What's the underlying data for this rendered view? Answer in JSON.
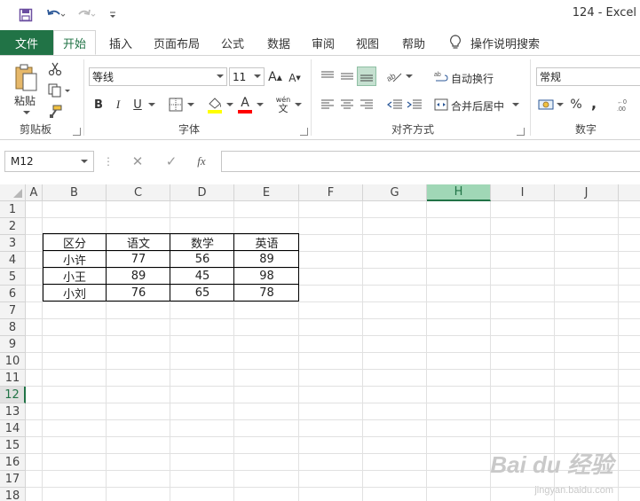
{
  "window": {
    "title": "124  -  Excel"
  },
  "tabs": [
    {
      "label": "文件"
    },
    {
      "label": "开始"
    },
    {
      "label": "插入"
    },
    {
      "label": "页面布局"
    },
    {
      "label": "公式"
    },
    {
      "label": "数据"
    },
    {
      "label": "审阅"
    },
    {
      "label": "视图"
    },
    {
      "label": "帮助"
    },
    {
      "label": "操作说明搜索"
    }
  ],
  "ribbon": {
    "clipboard": {
      "paste_label": "粘贴",
      "group_label": "剪贴板"
    },
    "font": {
      "name": "等线",
      "size": "11",
      "bold": "B",
      "italic": "I",
      "underline": "U",
      "grow": "A",
      "shrink": "A",
      "color_letter": "A",
      "phonetic": "wén",
      "phonetic_sub": "文",
      "group_label": "字体"
    },
    "alignment": {
      "wrap_label": "自动换行",
      "merge_label": "合并后居中",
      "group_label": "对齐方式"
    },
    "number": {
      "format": "常规",
      "percent": "%",
      "comma": ",",
      "group_label": "数字"
    }
  },
  "formula_bar": {
    "name_box": "M12",
    "fx": "fx",
    "cancel": "✕",
    "confirm": "✓",
    "value": ""
  },
  "sheet": {
    "columns": [
      "A",
      "B",
      "C",
      "D",
      "E",
      "F",
      "G",
      "H",
      "I",
      "J"
    ],
    "selected_column": "H",
    "rows": [
      "1",
      "2",
      "3",
      "4",
      "5",
      "6",
      "7",
      "8",
      "9",
      "10",
      "11",
      "12",
      "13",
      "14",
      "15",
      "16",
      "17",
      "18"
    ],
    "selected_row": "12",
    "table": [
      [
        "区分",
        "语文",
        "数学",
        "英语"
      ],
      [
        "小许",
        "77",
        "56",
        "89"
      ],
      [
        "小王",
        "89",
        "45",
        "98"
      ],
      [
        "小刘",
        "76",
        "65",
        "78"
      ]
    ]
  },
  "watermark": {
    "main": "Bai du 经验",
    "sub": "jingyan.baidu.com"
  },
  "colors": {
    "excel_green": "#217346",
    "selected_header": "#a0d7b6",
    "fill_yellow": "#ffff00",
    "font_red": "#ff0000"
  }
}
